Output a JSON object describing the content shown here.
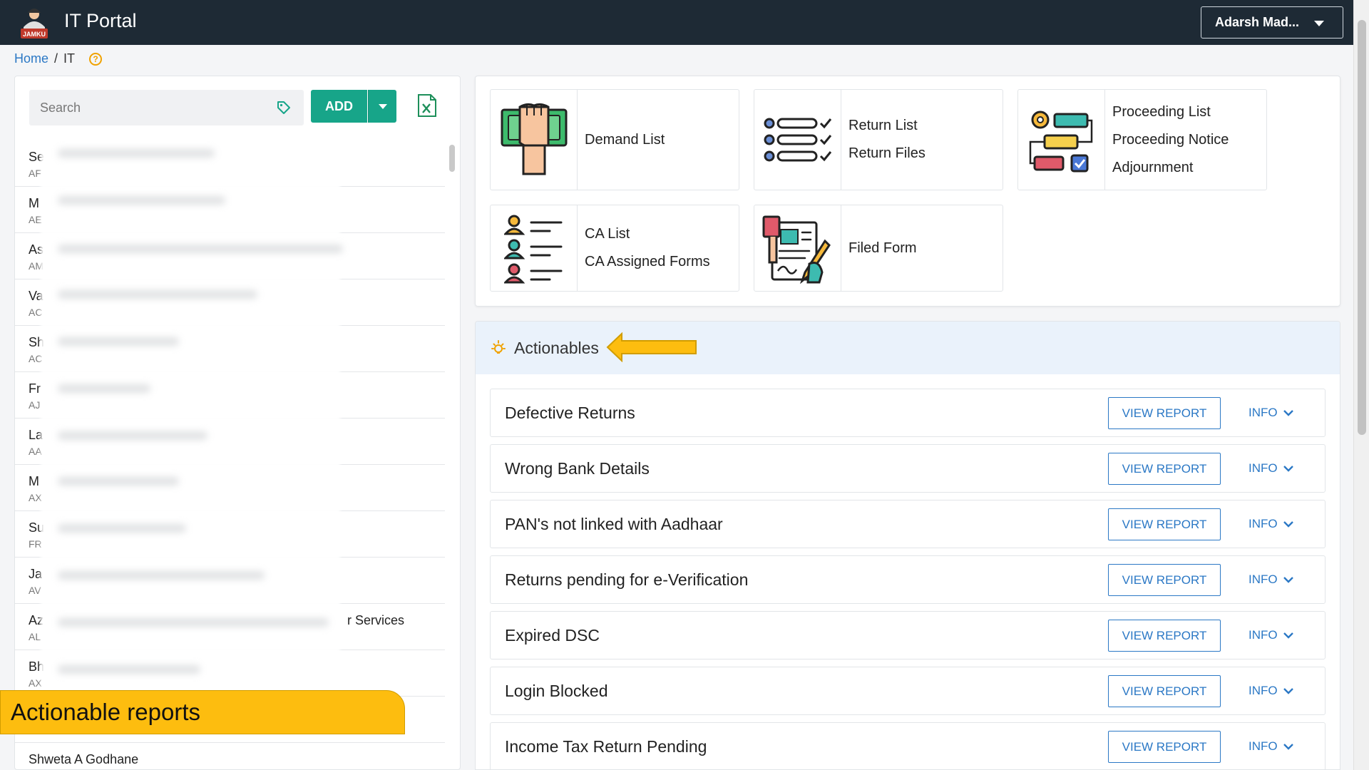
{
  "header": {
    "logo_text": "JAMKU",
    "app_title": "IT Portal",
    "user_name": "Adarsh Mad..."
  },
  "breadcrumb": {
    "home": "Home",
    "separator": "/",
    "current": "IT"
  },
  "left_panel": {
    "search_placeholder": "Search",
    "add_label": "ADD",
    "clients": [
      {
        "name": "Se",
        "code": "AF"
      },
      {
        "name": "M",
        "code": "AE"
      },
      {
        "name": "As",
        "code": "AM"
      },
      {
        "name": "Va",
        "code": "AC"
      },
      {
        "name": "Sh",
        "code": "AC"
      },
      {
        "name": "Fr",
        "code": "AJ"
      },
      {
        "name": "La",
        "code": "AA"
      },
      {
        "name": "M",
        "code": "AX"
      },
      {
        "name": "Su",
        "code": "FR"
      },
      {
        "name": "Ja",
        "code": "AV"
      },
      {
        "name": "Az",
        "code": "AL",
        "suffix": "r Services"
      },
      {
        "name": "Bh",
        "code": "AX"
      },
      {
        "name": "",
        "code": ""
      },
      {
        "name": "Shweta A Godhane",
        "code": ""
      }
    ],
    "callout": "Actionable reports"
  },
  "modules": {
    "demand": {
      "links": [
        "Demand List"
      ]
    },
    "returns": {
      "links": [
        "Return List",
        "Return Files"
      ]
    },
    "proceedings": {
      "links": [
        "Proceeding List",
        "Proceeding Notice",
        "Adjournment"
      ]
    },
    "ca": {
      "links": [
        "CA List",
        "CA Assigned Forms"
      ]
    },
    "filed": {
      "links": [
        "Filed Form"
      ]
    }
  },
  "actionables": {
    "title": "Actionables",
    "view_label": "VIEW REPORT",
    "info_label": "INFO",
    "items": [
      "Defective Returns",
      "Wrong Bank Details",
      "PAN's not linked with Aadhaar",
      "Returns pending for e-Verification",
      "Expired DSC",
      "Login Blocked",
      "Income Tax Return Pending"
    ]
  },
  "colors": {
    "topbar": "#1e2a35",
    "accent_green": "#17a589",
    "link_blue": "#2b78c5",
    "callout_yellow": "#fdbd0f",
    "actionables_header": "#eaf2fb"
  }
}
